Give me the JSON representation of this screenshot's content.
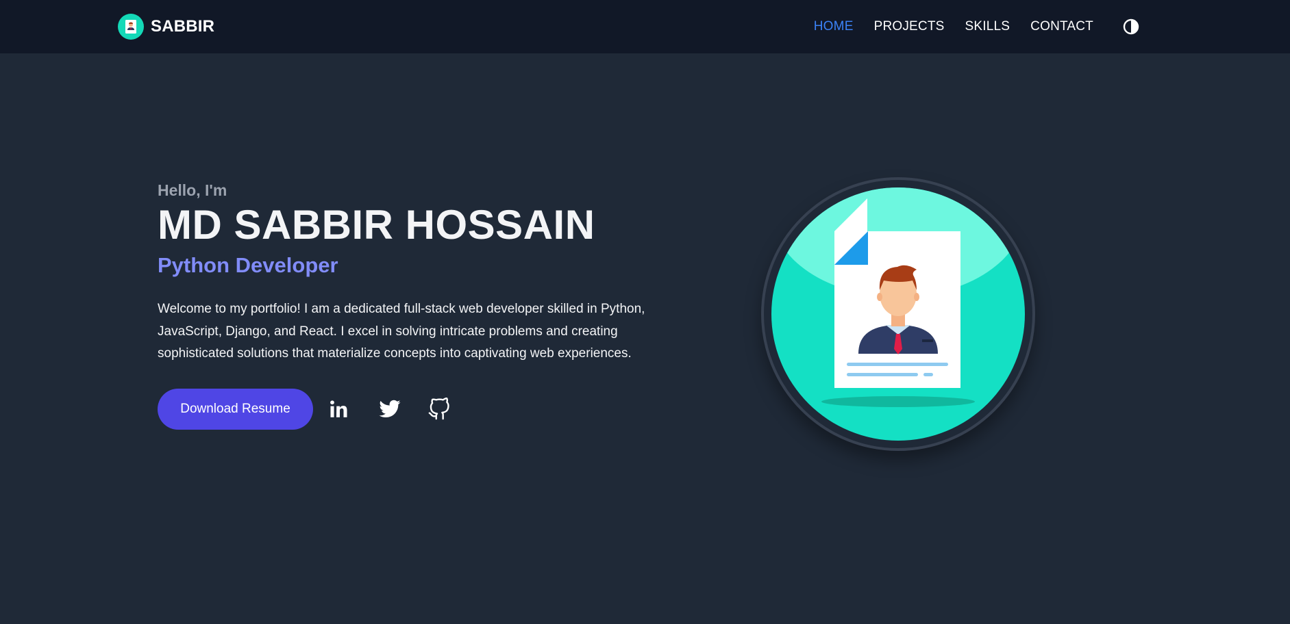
{
  "brand": {
    "name": "SABBIR"
  },
  "nav": {
    "items": [
      {
        "label": "HOME",
        "active": true
      },
      {
        "label": "PROJECTS",
        "active": false
      },
      {
        "label": "SKILLS",
        "active": false
      },
      {
        "label": "CONTACT",
        "active": false
      }
    ],
    "theme_toggle_icon": "contrast-icon"
  },
  "hero": {
    "greeting": "Hello, I'm",
    "name": "MD SABBIR HOSSAIN",
    "role": "Python Developer",
    "bio": "Welcome to my portfolio! I am a dedicated full-stack web developer skilled in Python, JavaScript, Django, and React. I excel in solving intricate problems and creating sophisticated solutions that materialize concepts into captivating web experiences.",
    "resume_button": "Download Resume",
    "social_icons": [
      "linkedin-icon",
      "twitter-icon",
      "github-icon"
    ]
  },
  "colors": {
    "background": "#1f2937",
    "navbar": "#111827",
    "accent_nav": "#3b82f6",
    "role": "#818cf8",
    "button": "#4f46e5",
    "avatar_teal": "#14e0c4"
  }
}
